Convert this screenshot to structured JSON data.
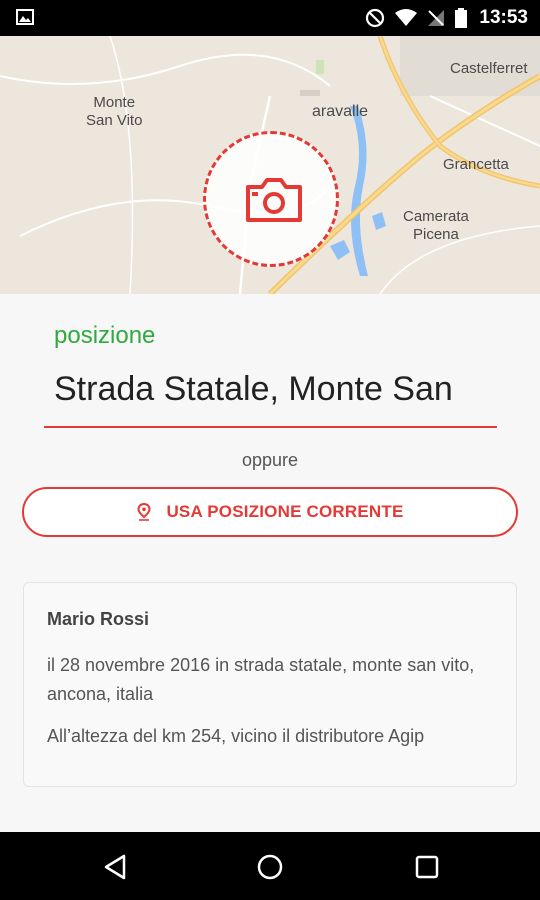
{
  "status_bar": {
    "time": "13:53",
    "icons": [
      "image-icon",
      "do-not-disturb-icon",
      "wifi-icon",
      "no-signal-icon",
      "battery-icon"
    ]
  },
  "map": {
    "labels": {
      "monte_san_vito": "Monte\nSan Vito",
      "chiaravalle": "aravalle",
      "castelferretti": "Castelferret",
      "grancetta": "Grancetta",
      "camerata_picena": "Camerata\nPicena"
    },
    "camera_button_icon": "camera-icon"
  },
  "form": {
    "position_label": "posizione",
    "position_value": "Strada Statale, Monte San",
    "or_text": "oppure",
    "use_current_button": "USA POSIZIONE CORRENTE",
    "use_current_icon": "location-pin-icon"
  },
  "report_card": {
    "author": "Mario Rossi",
    "description": "il 28 novembre 2016 in strada statale, monte san vito, ancona, italia",
    "note": "All’altezza del km 254, vicino il distributore Agip"
  },
  "nav_bar": {
    "icons": [
      "back-icon",
      "home-icon",
      "recents-icon"
    ]
  },
  "colors": {
    "accent_red": "#e53935",
    "label_green": "#2eaa3f",
    "road_orange": "#f2b544",
    "water_blue": "#7ab4f2"
  }
}
